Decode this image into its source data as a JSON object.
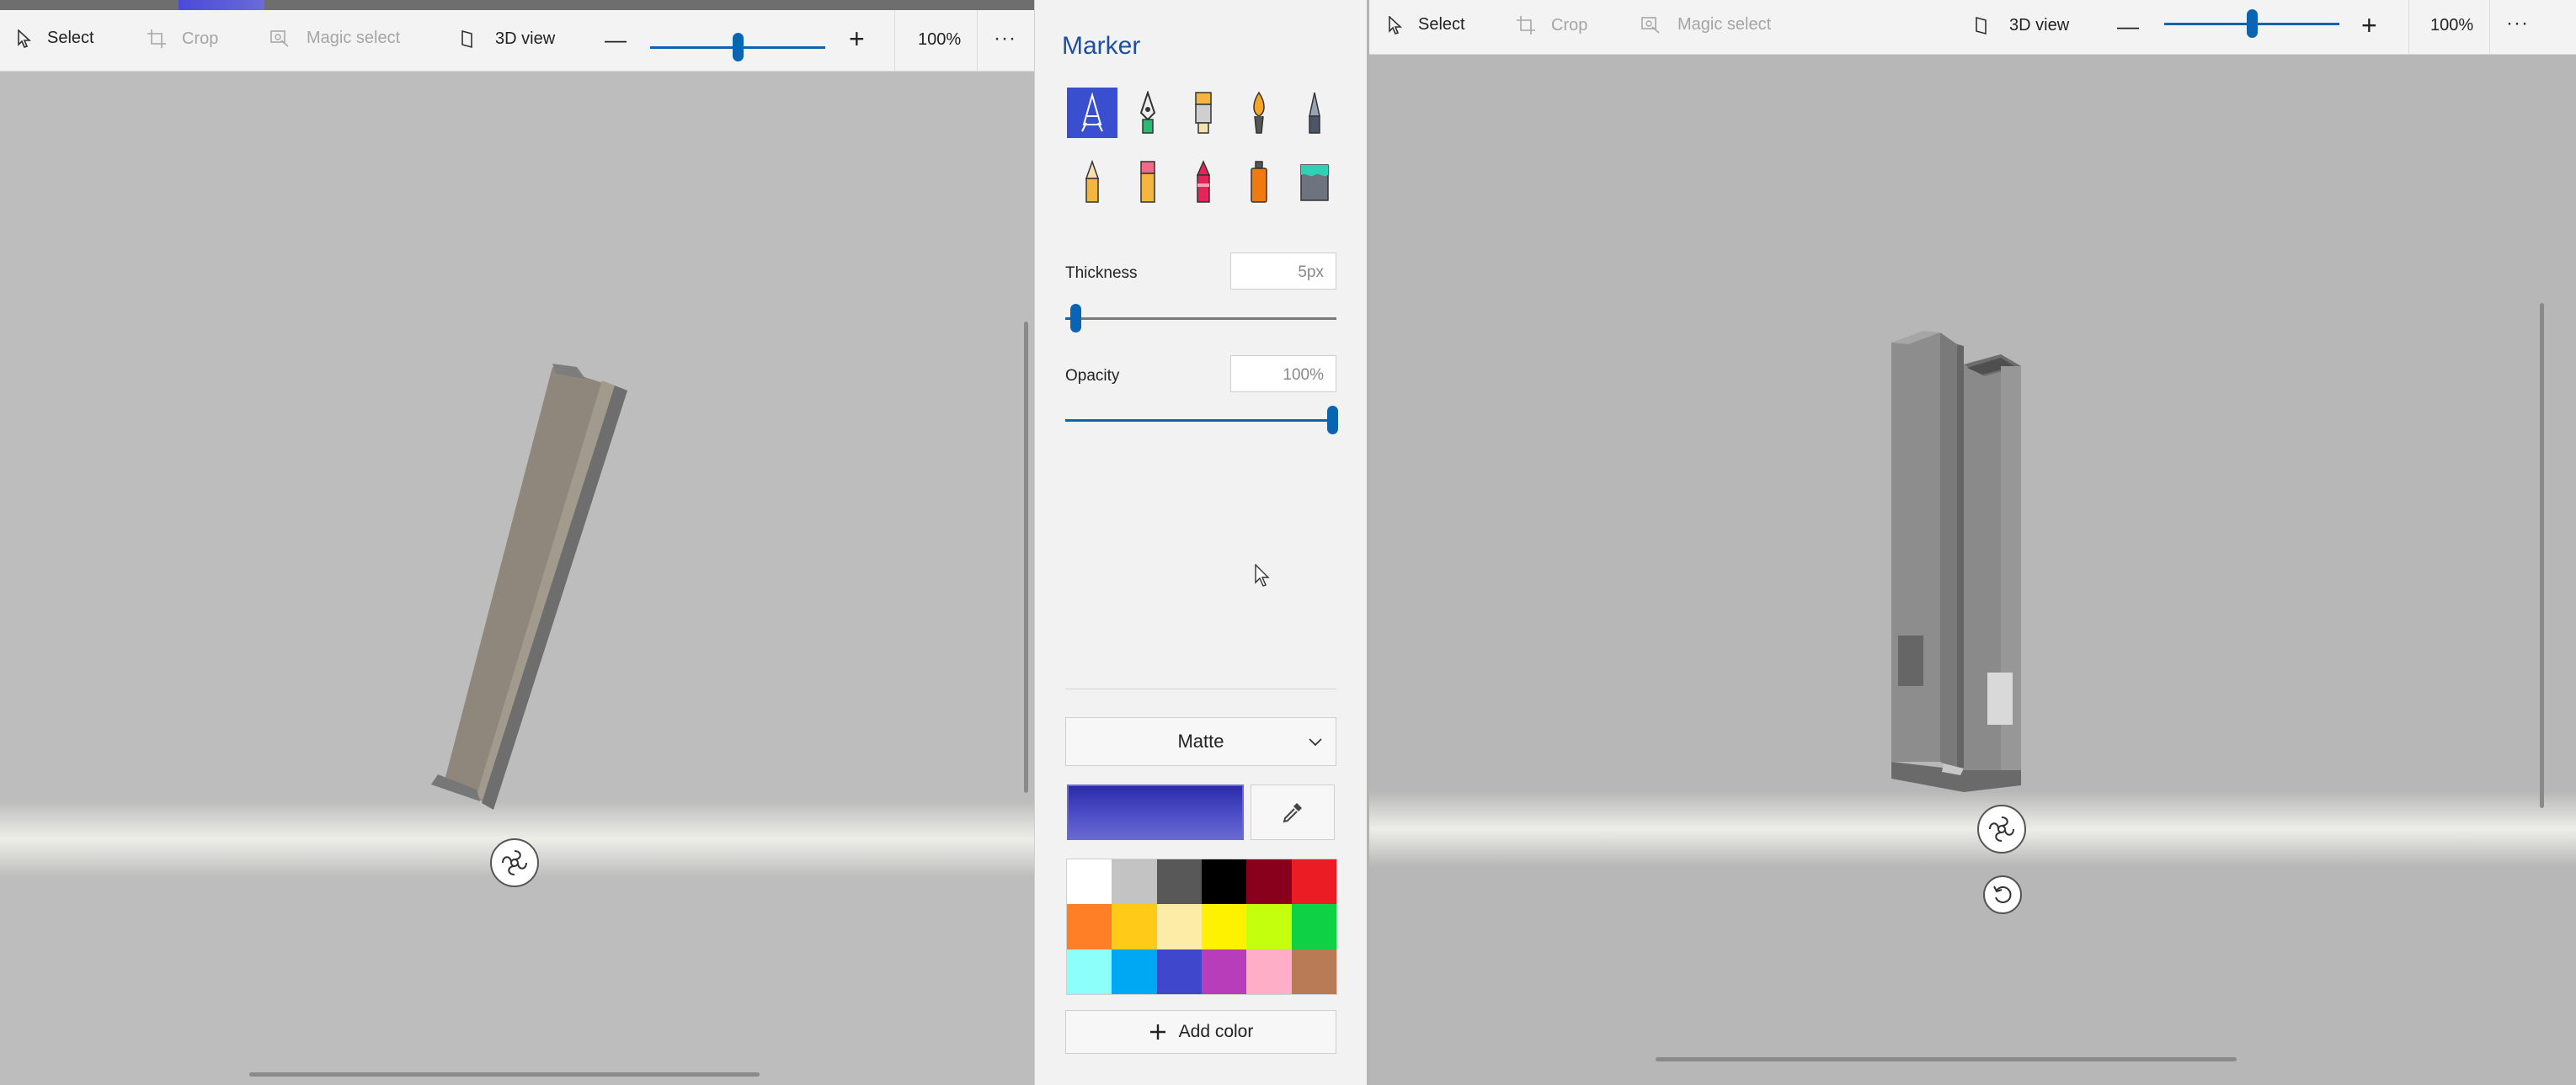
{
  "left_toolbar": {
    "select_label": "Select",
    "crop_label": "Crop",
    "magic_select_label": "Magic select",
    "view3d_label": "3D view",
    "zoom_percent": "100%",
    "zoom_level": 0.5,
    "more_label": "···"
  },
  "right_toolbar": {
    "select_label": "Select",
    "crop_label": "Crop",
    "magic_select_label": "Magic select",
    "view3d_label": "3D view",
    "zoom_percent": "100%",
    "zoom_level": 0.5,
    "more_label": "···"
  },
  "panel": {
    "title": "Marker",
    "brushes": [
      {
        "name": "marker",
        "selected": true
      },
      {
        "name": "calligraphy-pen",
        "selected": false
      },
      {
        "name": "oil-brush",
        "selected": false
      },
      {
        "name": "watercolor",
        "selected": false
      },
      {
        "name": "pixel-pen",
        "selected": false
      },
      {
        "name": "pencil",
        "selected": false
      },
      {
        "name": "eraser",
        "selected": false
      },
      {
        "name": "crayon",
        "selected": false
      },
      {
        "name": "spray-can",
        "selected": false
      },
      {
        "name": "fill",
        "selected": false
      }
    ],
    "thickness_label": "Thickness",
    "thickness_value": "5px",
    "thickness_level": 0.03,
    "opacity_label": "Opacity",
    "opacity_value": "100%",
    "opacity_level": 1.0,
    "finish_value": "Matte",
    "selected_color": "#3a3ab8",
    "palette": [
      "#ffffff",
      "#c3c3c3",
      "#585858",
      "#000000",
      "#88001b",
      "#ec1c24",
      "#ff7f27",
      "#ffca18",
      "#fdeca6",
      "#fff200",
      "#c4ff0e",
      "#0ed145",
      "#8cfffb",
      "#00a8f3",
      "#3f48cc",
      "#b83dba",
      "#ffaec8",
      "#b97a56"
    ],
    "add_color_label": "Add color"
  },
  "colors": {
    "accent": "#0a64b4",
    "title_blue": "#1f4fa0"
  }
}
